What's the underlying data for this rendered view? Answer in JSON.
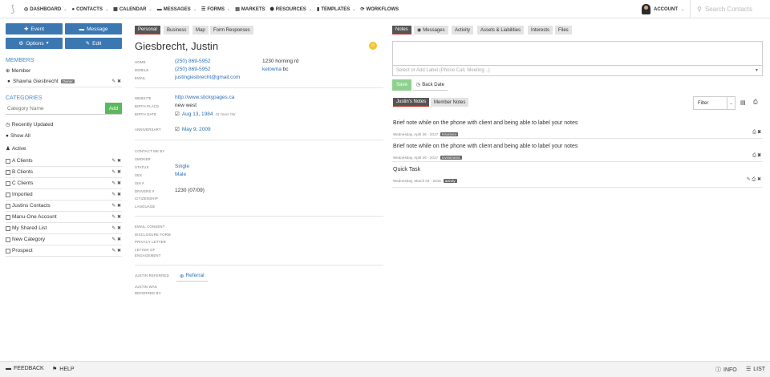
{
  "topnav": {
    "items": [
      {
        "icon": "dashboard-icon",
        "label": "DASHBOARD",
        "has_dropdown": true
      },
      {
        "icon": "contacts-icon",
        "label": "CONTACTS",
        "has_dropdown": true
      },
      {
        "icon": "calendar-icon",
        "label": "CALENDAR",
        "has_dropdown": true
      },
      {
        "icon": "messages-icon",
        "label": "MESSAGES",
        "has_dropdown": true
      },
      {
        "icon": "forms-icon",
        "label": "FORMS",
        "has_dropdown": true
      },
      {
        "icon": "markets-icon",
        "label": "MARKETS",
        "has_dropdown": false
      },
      {
        "icon": "resources-icon",
        "label": "RESOURCES",
        "has_dropdown": true
      },
      {
        "icon": "templates-icon",
        "label": "TEMPLATES",
        "has_dropdown": true
      },
      {
        "icon": "workflows-icon",
        "label": "WORKFLOWS",
        "has_dropdown": false
      }
    ],
    "account_label": "ACCOUNT",
    "search_placeholder": "Search Contacts"
  },
  "left": {
    "event_label": "Event",
    "message_label": "Message",
    "options_label": "Options",
    "edit_label": "Edit",
    "members_title": "MEMBERS",
    "member_label": "Member",
    "member_name": "Shawna Giesbrecht",
    "member_badge": "Owner",
    "categories_title": "CATEGORIES",
    "category_placeholder": "Category Name",
    "add_label": "Add",
    "recently_updated": "Recently Updated",
    "show_all": "Show All",
    "active": "Active",
    "categories": [
      "A Clients",
      "B Clients",
      "C Clients",
      "Imported",
      "Justins Contacts",
      "Manu-One Account",
      "My Shared List",
      "New Category",
      "Prospect"
    ]
  },
  "contact": {
    "tabs": [
      "Personal",
      "Business",
      "Map",
      "Form Responses"
    ],
    "name": "Giesbrecht, Justin",
    "home_label": "HOME",
    "home": "(250) 869-5952",
    "mobile_label": "MOBILE",
    "mobile": "(250) 869-5952",
    "email_label": "EMAIL",
    "email": "justingiesbrecht@gmail.com",
    "address_line1": "1230 horning rd",
    "address_city": "kelowna",
    "address_prov": "bc",
    "website_label": "WEBSITE",
    "website": "http://www.stickypages.ca",
    "birth_place_label": "BIRTH PLACE",
    "birth_place": "new west",
    "birth_date_label": "BIRTH DATE",
    "birth_date": "Aug 13, 1984",
    "age_note": "33 Years Old",
    "anniversary_label": "ANNIVERSARY",
    "anniversary": "May 9, 2009",
    "contact_me_by_label": "CONTACT ME BY",
    "smoker_label": "SMOKER",
    "status_label": "STATUS",
    "status": "Single",
    "sex_label": "SEX",
    "sex": "Male",
    "sin_label": "SIN #",
    "drivers_label": "DRIVERS #",
    "drivers": "1230 (07/09)",
    "citizenship_label": "CITIZENSHIP",
    "language_label": "LANGUAGE",
    "email_consent_label": "EMAIL CONSENT",
    "disclosure_label": "DISCLOSURE FORM",
    "privacy_label": "PRIVACY LETTER",
    "engagement_label1": "LETTER OF",
    "engagement_label2": "ENGAGEMENT",
    "referred_label": "JUSTIN REFERRED",
    "referral_button": "Referral",
    "referred_by_label1": "JUSTIN WAS",
    "referred_by_label2": "REFERRED BY"
  },
  "notes": {
    "tabs": [
      "Notes",
      "Messages",
      "Activity",
      "Assets & Liabilities",
      "Interests",
      "Files"
    ],
    "label_placeholder": "Select or Add Label  (Phone Call, Meeting ..)",
    "save_label": "Save",
    "back_date_label": "Back Date",
    "subtabs": [
      "Justin's Notes",
      "Member Notes"
    ],
    "filter_label": "Filter",
    "items": [
      {
        "text": "Brief note while on the phone with client and being able to label your notes",
        "date": "Wednesday, April 26 - 2017",
        "tag": "Insurance"
      },
      {
        "text": "Brief note while on the phone with client and being able to label your notes",
        "date": "Wednesday, April 26 - 2017",
        "tag": "Investments"
      },
      {
        "text": "Quick Task",
        "date": "Wednesday, March 04 - 2015",
        "tag": "activity"
      }
    ]
  },
  "footer": {
    "feedback": "FEEDBACK",
    "help": "HELP",
    "info": "INFO",
    "list": "LIST"
  },
  "colors": {
    "primary_blue": "#3b78b2",
    "link_blue": "#2e6fb7",
    "green": "#5cb85c",
    "active_tab": "#555555",
    "accent_red": "#c0392b",
    "badge_yellow": "#f4c430"
  }
}
